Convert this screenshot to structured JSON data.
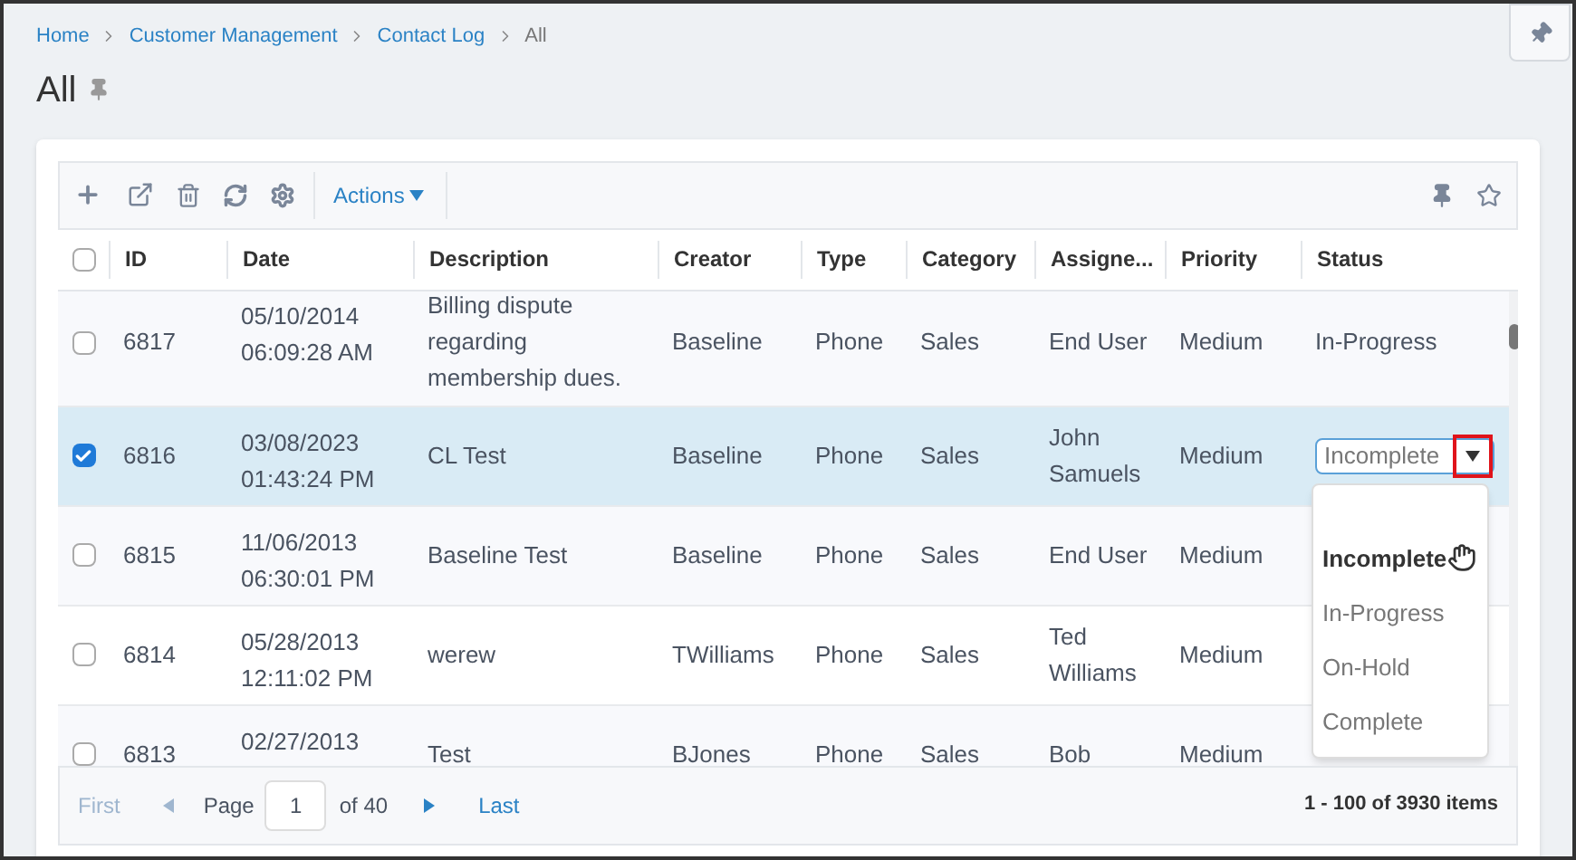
{
  "breadcrumb": [
    {
      "label": "Home",
      "current": false
    },
    {
      "label": "Customer Management",
      "current": false
    },
    {
      "label": "Contact Log",
      "current": false
    },
    {
      "label": "All",
      "current": true
    }
  ],
  "title": "All",
  "toolbar": {
    "actions_label": "Actions"
  },
  "table": {
    "columns": [
      "ID",
      "Date",
      "Description",
      "Creator",
      "Type",
      "Category",
      "Assigne...",
      "Priority",
      "Status"
    ],
    "select_all_checked": false,
    "rows": [
      {
        "checked": false,
        "id": "6817",
        "date": [
          "05/10/2014",
          "06:09:28 AM"
        ],
        "description": "Billing dispute regarding membership dues.",
        "creator": "Baseline",
        "type": "Phone",
        "category": "Sales",
        "assignee": "End User",
        "priority": "Medium",
        "status": {
          "kind": "text",
          "value": "In-Progress"
        }
      },
      {
        "checked": true,
        "id": "6816",
        "date": [
          "03/08/2023",
          "01:43:24 PM"
        ],
        "description": "CL Test",
        "creator": "Baseline",
        "type": "Phone",
        "category": "Sales",
        "assignee": "John Samuels",
        "priority": "Medium",
        "status": {
          "kind": "select",
          "value": "Incomplete",
          "expanded": true,
          "options": [
            {
              "label": "Incomplete",
              "selected": true
            },
            {
              "label": "In-Progress",
              "selected": false
            },
            {
              "label": "On-Hold",
              "selected": false
            },
            {
              "label": "Complete",
              "selected": false
            }
          ]
        }
      },
      {
        "checked": false,
        "id": "6815",
        "date": [
          "11/06/2013",
          "06:30:01 PM"
        ],
        "description": "Baseline Test",
        "creator": "Baseline",
        "type": "Phone",
        "category": "Sales",
        "assignee": "End User",
        "priority": "Medium"
      },
      {
        "checked": false,
        "id": "6814",
        "date": [
          "05/28/2013",
          "12:11:02 PM"
        ],
        "description": "werew",
        "creator": "TWilliams",
        "type": "Phone",
        "category": "Sales",
        "assignee": "Ted Williams",
        "priority": "Medium"
      },
      {
        "checked": false,
        "id": "6813",
        "date": [
          "02/27/2013"
        ],
        "description": "Test",
        "creator": "BJones",
        "type": "Phone",
        "category": "Sales",
        "assignee": "Bob",
        "priority": "Medium"
      }
    ]
  },
  "pager": {
    "first": {
      "label": "First",
      "disabled": true
    },
    "prev_disabled": true,
    "page_label": "Page",
    "page": "1",
    "of_label": "of 40",
    "next_disabled": false,
    "last": {
      "label": "Last",
      "disabled": false
    },
    "summary": "1 - 100 of 3930 items"
  }
}
